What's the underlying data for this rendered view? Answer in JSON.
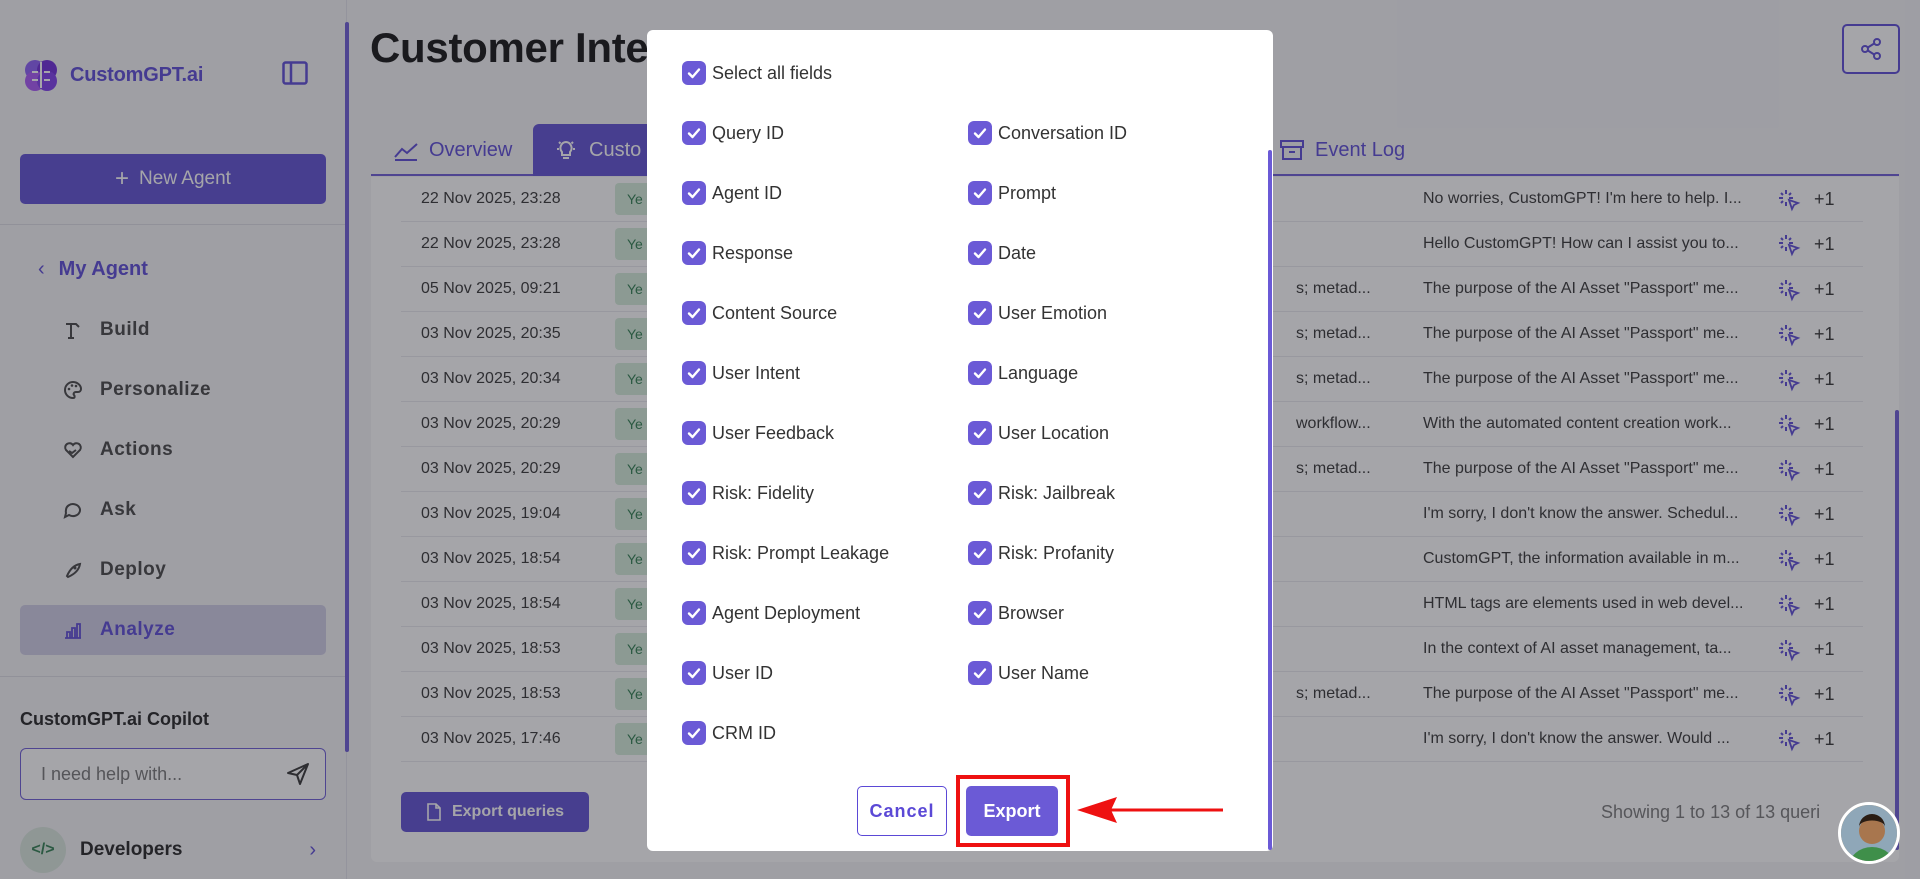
{
  "app": {
    "logo_text": "CustomGPT.ai"
  },
  "sidebar": {
    "new_agent_label": "New Agent",
    "section_label": "My Agent",
    "items": [
      {
        "label": "Build",
        "icon": "build-icon"
      },
      {
        "label": "Personalize",
        "icon": "palette-icon"
      },
      {
        "label": "Actions",
        "icon": "heart-hand-icon"
      },
      {
        "label": "Ask",
        "icon": "chat-bubble-icon"
      },
      {
        "label": "Deploy",
        "icon": "rocket-icon"
      },
      {
        "label": "Analyze",
        "icon": "bar-chart-icon",
        "active": true
      }
    ],
    "copilot_title": "CustomGPT.ai Copilot",
    "copilot_placeholder": "I need help with...",
    "developers_label": "Developers"
  },
  "main": {
    "title": "Customer Intell",
    "tabs": [
      {
        "label": "Overview"
      },
      {
        "label": "Custo"
      },
      {
        "label": "Event Log"
      }
    ],
    "rows": [
      {
        "date": "22 Nov 2025, 23:28",
        "badge": "Ye",
        "mid": "",
        "response": "No worries, CustomGPT! I'm here to help. I...",
        "count": "+1"
      },
      {
        "date": "22 Nov 2025, 23:28",
        "badge": "Ye",
        "mid": "",
        "response": "Hello CustomGPT! How can I assist you to...",
        "count": "+1"
      },
      {
        "date": "05 Nov 2025, 09:21",
        "badge": "Ye",
        "mid": "s; metad...",
        "response": "The purpose of the AI Asset \"Passport\" me...",
        "count": "+1"
      },
      {
        "date": "03 Nov 2025, 20:35",
        "badge": "Ye",
        "mid": "s; metad...",
        "response": "The purpose of the AI Asset \"Passport\" me...",
        "count": "+1"
      },
      {
        "date": "03 Nov 2025, 20:34",
        "badge": "Ye",
        "mid": "s; metad...",
        "response": "The purpose of the AI Asset \"Passport\" me...",
        "count": "+1"
      },
      {
        "date": "03 Nov 2025, 20:29",
        "badge": "Ye",
        "mid": "workflow...",
        "response": "With the automated content creation work...",
        "count": "+1"
      },
      {
        "date": "03 Nov 2025, 20:29",
        "badge": "Ye",
        "mid": "s; metad...",
        "response": "The purpose of the AI Asset \"Passport\" me...",
        "count": "+1"
      },
      {
        "date": "03 Nov 2025, 19:04",
        "badge": "Ye",
        "mid": "",
        "response": "I'm sorry, I don't know the answer. Schedul...",
        "count": "+1"
      },
      {
        "date": "03 Nov 2025, 18:54",
        "badge": "Ye",
        "mid": "",
        "response": "CustomGPT, the information available in m...",
        "count": "+1"
      },
      {
        "date": "03 Nov 2025, 18:54",
        "badge": "Ye",
        "mid": "",
        "response": "HTML tags are elements used in web devel...",
        "count": "+1"
      },
      {
        "date": "03 Nov 2025, 18:53",
        "badge": "Ye",
        "mid": "",
        "response": "In the context of AI asset management, ta...",
        "count": "+1"
      },
      {
        "date": "03 Nov 2025, 18:53",
        "badge": "Ye",
        "mid": "s; metad...",
        "response": "The purpose of the AI Asset \"Passport\" me...",
        "count": "+1"
      },
      {
        "date": "03 Nov 2025, 17:46",
        "badge": "Ye",
        "mid": "",
        "response": "I'm sorry, I don't know the answer. Would ...",
        "count": "+1"
      }
    ],
    "export_queries_label": "Export queries",
    "showing_text": "Showing 1 to 13 of 13 queri"
  },
  "modal": {
    "select_all_label": "Select all fields",
    "fields": [
      {
        "label": "Query ID",
        "checked": true
      },
      {
        "label": "Conversation ID",
        "checked": true
      },
      {
        "label": "Agent ID",
        "checked": true
      },
      {
        "label": "Prompt",
        "checked": true
      },
      {
        "label": "Response",
        "checked": true
      },
      {
        "label": "Date",
        "checked": true
      },
      {
        "label": "Content Source",
        "checked": true
      },
      {
        "label": "User Emotion",
        "checked": true
      },
      {
        "label": "User Intent",
        "checked": true
      },
      {
        "label": "Language",
        "checked": true
      },
      {
        "label": "User Feedback",
        "checked": true
      },
      {
        "label": "User Location",
        "checked": true
      },
      {
        "label": "Risk: Fidelity",
        "checked": true
      },
      {
        "label": "Risk: Jailbreak",
        "checked": true
      },
      {
        "label": "Risk: Prompt Leakage",
        "checked": true
      },
      {
        "label": "Risk: Profanity",
        "checked": true
      },
      {
        "label": "Agent Deployment",
        "checked": true
      },
      {
        "label": "Browser",
        "checked": true
      },
      {
        "label": "User ID",
        "checked": true
      },
      {
        "label": "User Name",
        "checked": true
      },
      {
        "label": "CRM ID",
        "checked": true
      }
    ],
    "cancel_label": "Cancel",
    "export_label": "Export"
  },
  "colors": {
    "accent": "#5e4fd2",
    "highlight": "#ee1111",
    "badge_bg": "#d4edda"
  }
}
